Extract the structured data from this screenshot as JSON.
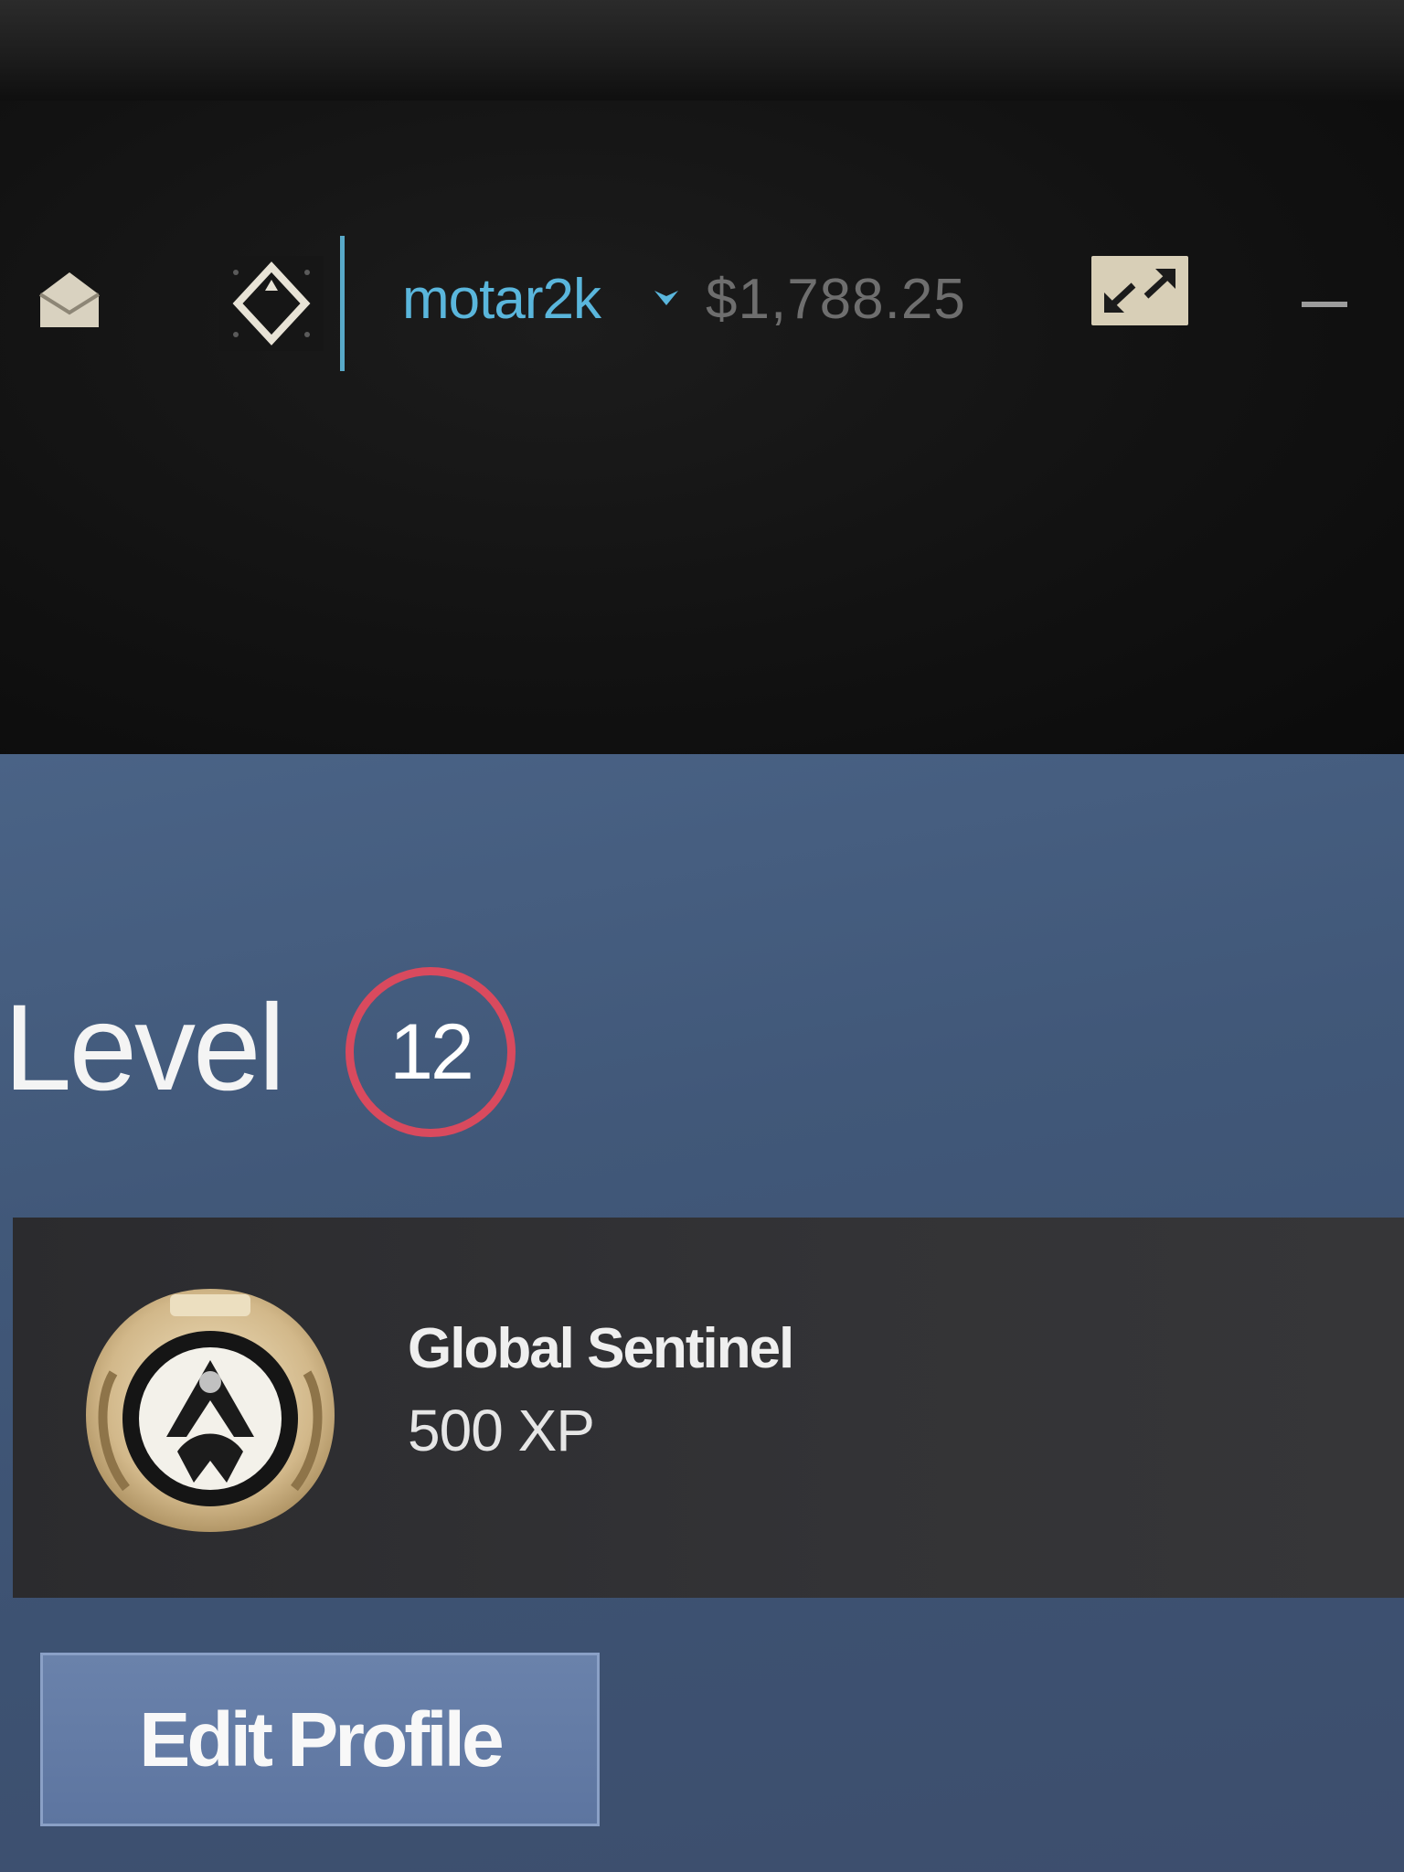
{
  "header": {
    "username": "motar2k",
    "balance": "$1,788.25",
    "icons": {
      "mail": "envelope-icon",
      "badge": "diamond-badge-icon",
      "dropdown": "chevron-down-icon",
      "fullscreen": "expand-arrows-icon",
      "minimize": "minimize-icon"
    },
    "colors": {
      "username": "#5ab6dc",
      "divider": "#58a9c8"
    }
  },
  "profile": {
    "level_label": "Level",
    "level_value": "12",
    "level_ring_color": "#d94a5e",
    "badge": {
      "name": "Global Sentinel",
      "xp": "500 XP",
      "icon": "medal-icon"
    },
    "edit_profile_label": "Edit Profile"
  }
}
